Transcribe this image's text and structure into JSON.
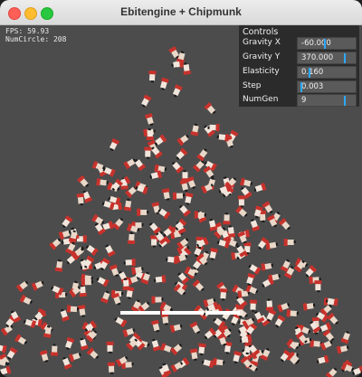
{
  "window": {
    "title": "Ebitengine + Chipmunk"
  },
  "debug": {
    "fps": "FPS: 59.93",
    "num_circle": "NumCircle: 208"
  },
  "controls": {
    "title": "Controls",
    "rows": [
      {
        "label": "Gravity X",
        "value": "-60.000",
        "level": 0.45
      },
      {
        "label": "Gravity Y",
        "value": "370.000",
        "level": 0.82
      },
      {
        "label": "Elasticity",
        "value": "0.160",
        "level": 0.16
      },
      {
        "label": "Step",
        "value": "0.003",
        "level": 0.02
      },
      {
        "label": "NumGen",
        "value": "9",
        "level": 0.82
      }
    ]
  },
  "colors": {
    "slider": "#2ea8ff",
    "floor": "#ffffff",
    "background": "#4c4c4c"
  }
}
